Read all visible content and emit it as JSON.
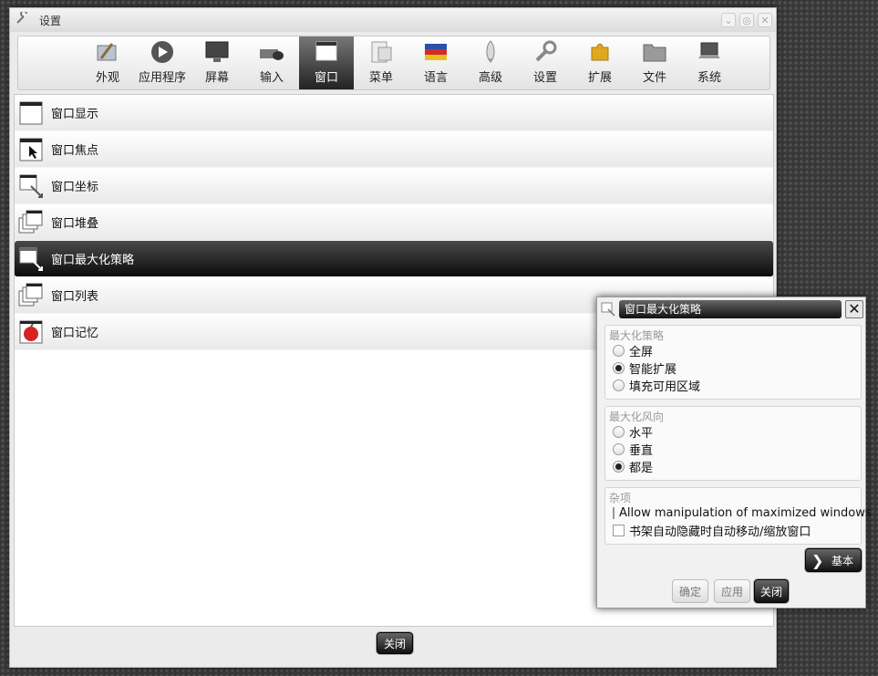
{
  "window": {
    "title": "设置",
    "close_button": "关闭"
  },
  "toolbar": {
    "items": [
      {
        "label": "外观",
        "icon": "appearance-icon"
      },
      {
        "label": "应用程序",
        "icon": "applications-icon"
      },
      {
        "label": "屏幕",
        "icon": "screen-icon"
      },
      {
        "label": "输入",
        "icon": "input-icon"
      },
      {
        "label": "窗口",
        "icon": "window-icon",
        "active": true
      },
      {
        "label": "菜单",
        "icon": "menu-icon"
      },
      {
        "label": "语言",
        "icon": "language-icon"
      },
      {
        "label": "高级",
        "icon": "advanced-icon"
      },
      {
        "label": "设置",
        "icon": "settings-icon"
      },
      {
        "label": "扩展",
        "icon": "extensions-icon"
      },
      {
        "label": "文件",
        "icon": "files-icon"
      },
      {
        "label": "系统",
        "icon": "system-icon"
      }
    ]
  },
  "list": {
    "items": [
      {
        "label": "窗口显示",
        "icon": "window-display-icon"
      },
      {
        "label": "窗口焦点",
        "icon": "window-focus-icon"
      },
      {
        "label": "窗口坐标",
        "icon": "window-geometry-icon"
      },
      {
        "label": "窗口堆叠",
        "icon": "window-stacking-icon"
      },
      {
        "label": "窗口最大化策略",
        "icon": "window-maximize-icon",
        "selected": true
      },
      {
        "label": "窗口列表",
        "icon": "window-list-icon"
      },
      {
        "label": "窗口记忆",
        "icon": "window-remember-icon"
      }
    ]
  },
  "dialog": {
    "title": "窗口最大化策略",
    "policy": {
      "title": "最大化策略",
      "options": [
        {
          "label": "全屏",
          "selected": false
        },
        {
          "label": "智能扩展",
          "selected": true
        },
        {
          "label": "填充可用区域",
          "selected": false
        }
      ]
    },
    "direction": {
      "title": "最大化风向",
      "options": [
        {
          "label": "水平",
          "selected": false
        },
        {
          "label": "垂直",
          "selected": false
        },
        {
          "label": "都是",
          "selected": true
        }
      ]
    },
    "misc": {
      "title": "杂项",
      "options": [
        {
          "label": "Allow manipulation of maximized windows",
          "checked": false
        },
        {
          "label": "书架自动隐藏时自动移动/缩放窗口",
          "checked": false
        }
      ]
    },
    "basic_button": "基本",
    "ok_button": "确定",
    "apply_button": "应用",
    "close_button": "关闭"
  }
}
